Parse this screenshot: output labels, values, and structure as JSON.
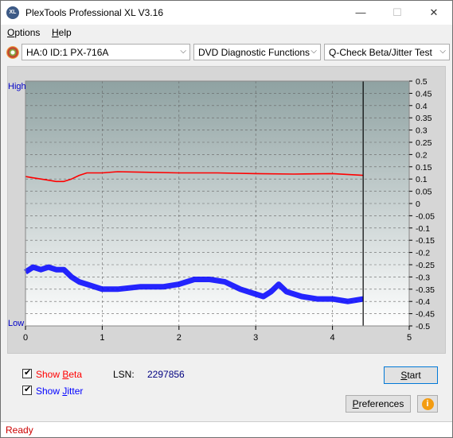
{
  "window": {
    "title": "PlexTools Professional XL V3.16",
    "icon_text": "XL",
    "minimize": "—",
    "maximize": "☐",
    "close": "✕"
  },
  "menu": {
    "options_first": "O",
    "options_rest": "ptions",
    "help_first": "H",
    "help_rest": "elp"
  },
  "toolbar": {
    "drive": "HA:0 ID:1  PX-716A",
    "function": "DVD Diagnostic Functions",
    "test": "Q-Check Beta/Jitter Test",
    "arrow": "⌵"
  },
  "colors": {
    "beta": "#ff0000",
    "jitter": "#0000ff",
    "plot_top": "#8fa2a2",
    "plot_bottom": "#ffffff"
  },
  "chart_data": {
    "type": "line",
    "left_labels": {
      "high": "High",
      "low": "Low"
    },
    "x_ticks": [
      "0",
      "1",
      "2",
      "3",
      "4",
      "5"
    ],
    "xlim": [
      0,
      5
    ],
    "y_ticks": [
      "0.5",
      "0.45",
      "0.4",
      "0.35",
      "0.3",
      "0.25",
      "0.2",
      "0.15",
      "0.1",
      "0.05",
      "0",
      "-0.05",
      "-0.1",
      "-0.15",
      "-0.2",
      "-0.25",
      "-0.3",
      "-0.35",
      "-0.4",
      "-0.45",
      "-0.5"
    ],
    "ylim": [
      -0.5,
      0.5
    ],
    "end_marker_x": 4.4,
    "grid": true,
    "series": [
      {
        "key": "beta",
        "color": "#ff0000",
        "x": [
          0,
          0.1,
          0.2,
          0.3,
          0.4,
          0.5,
          0.6,
          0.7,
          0.8,
          1.0,
          1.2,
          1.5,
          2.0,
          2.5,
          3.0,
          3.5,
          4.0,
          4.4
        ],
        "y": [
          0.11,
          0.105,
          0.1,
          0.095,
          0.09,
          0.09,
          0.1,
          0.115,
          0.125,
          0.125,
          0.13,
          0.128,
          0.125,
          0.125,
          0.122,
          0.12,
          0.122,
          0.115
        ]
      },
      {
        "key": "jitter",
        "color": "#0000ff",
        "x": [
          0,
          0.1,
          0.2,
          0.3,
          0.4,
          0.5,
          0.6,
          0.7,
          0.8,
          1.0,
          1.2,
          1.5,
          1.8,
          2.0,
          2.2,
          2.4,
          2.6,
          2.8,
          3.0,
          3.1,
          3.2,
          3.3,
          3.4,
          3.6,
          3.8,
          4.0,
          4.2,
          4.4
        ],
        "y": [
          -0.28,
          -0.26,
          -0.27,
          -0.26,
          -0.27,
          -0.27,
          -0.3,
          -0.32,
          -0.33,
          -0.35,
          -0.35,
          -0.34,
          -0.34,
          -0.33,
          -0.31,
          -0.31,
          -0.32,
          -0.35,
          -0.37,
          -0.38,
          -0.36,
          -0.33,
          -0.36,
          -0.38,
          -0.39,
          -0.39,
          -0.4,
          -0.39
        ]
      }
    ]
  },
  "controls": {
    "show_beta_prefix": "Show ",
    "show_beta_hot": "B",
    "show_beta_rest": "eta",
    "show_jitter_prefix": "Show ",
    "show_jitter_hot": "J",
    "show_jitter_rest": "itter",
    "check_mark": "✔",
    "lsn_label": "LSN:",
    "lsn_value": "2297856",
    "start_hot": "S",
    "start_rest": "tart",
    "preferences_prefix": "P",
    "preferences_rest": "references",
    "info_icon": "i"
  },
  "status": {
    "text": "Ready"
  }
}
